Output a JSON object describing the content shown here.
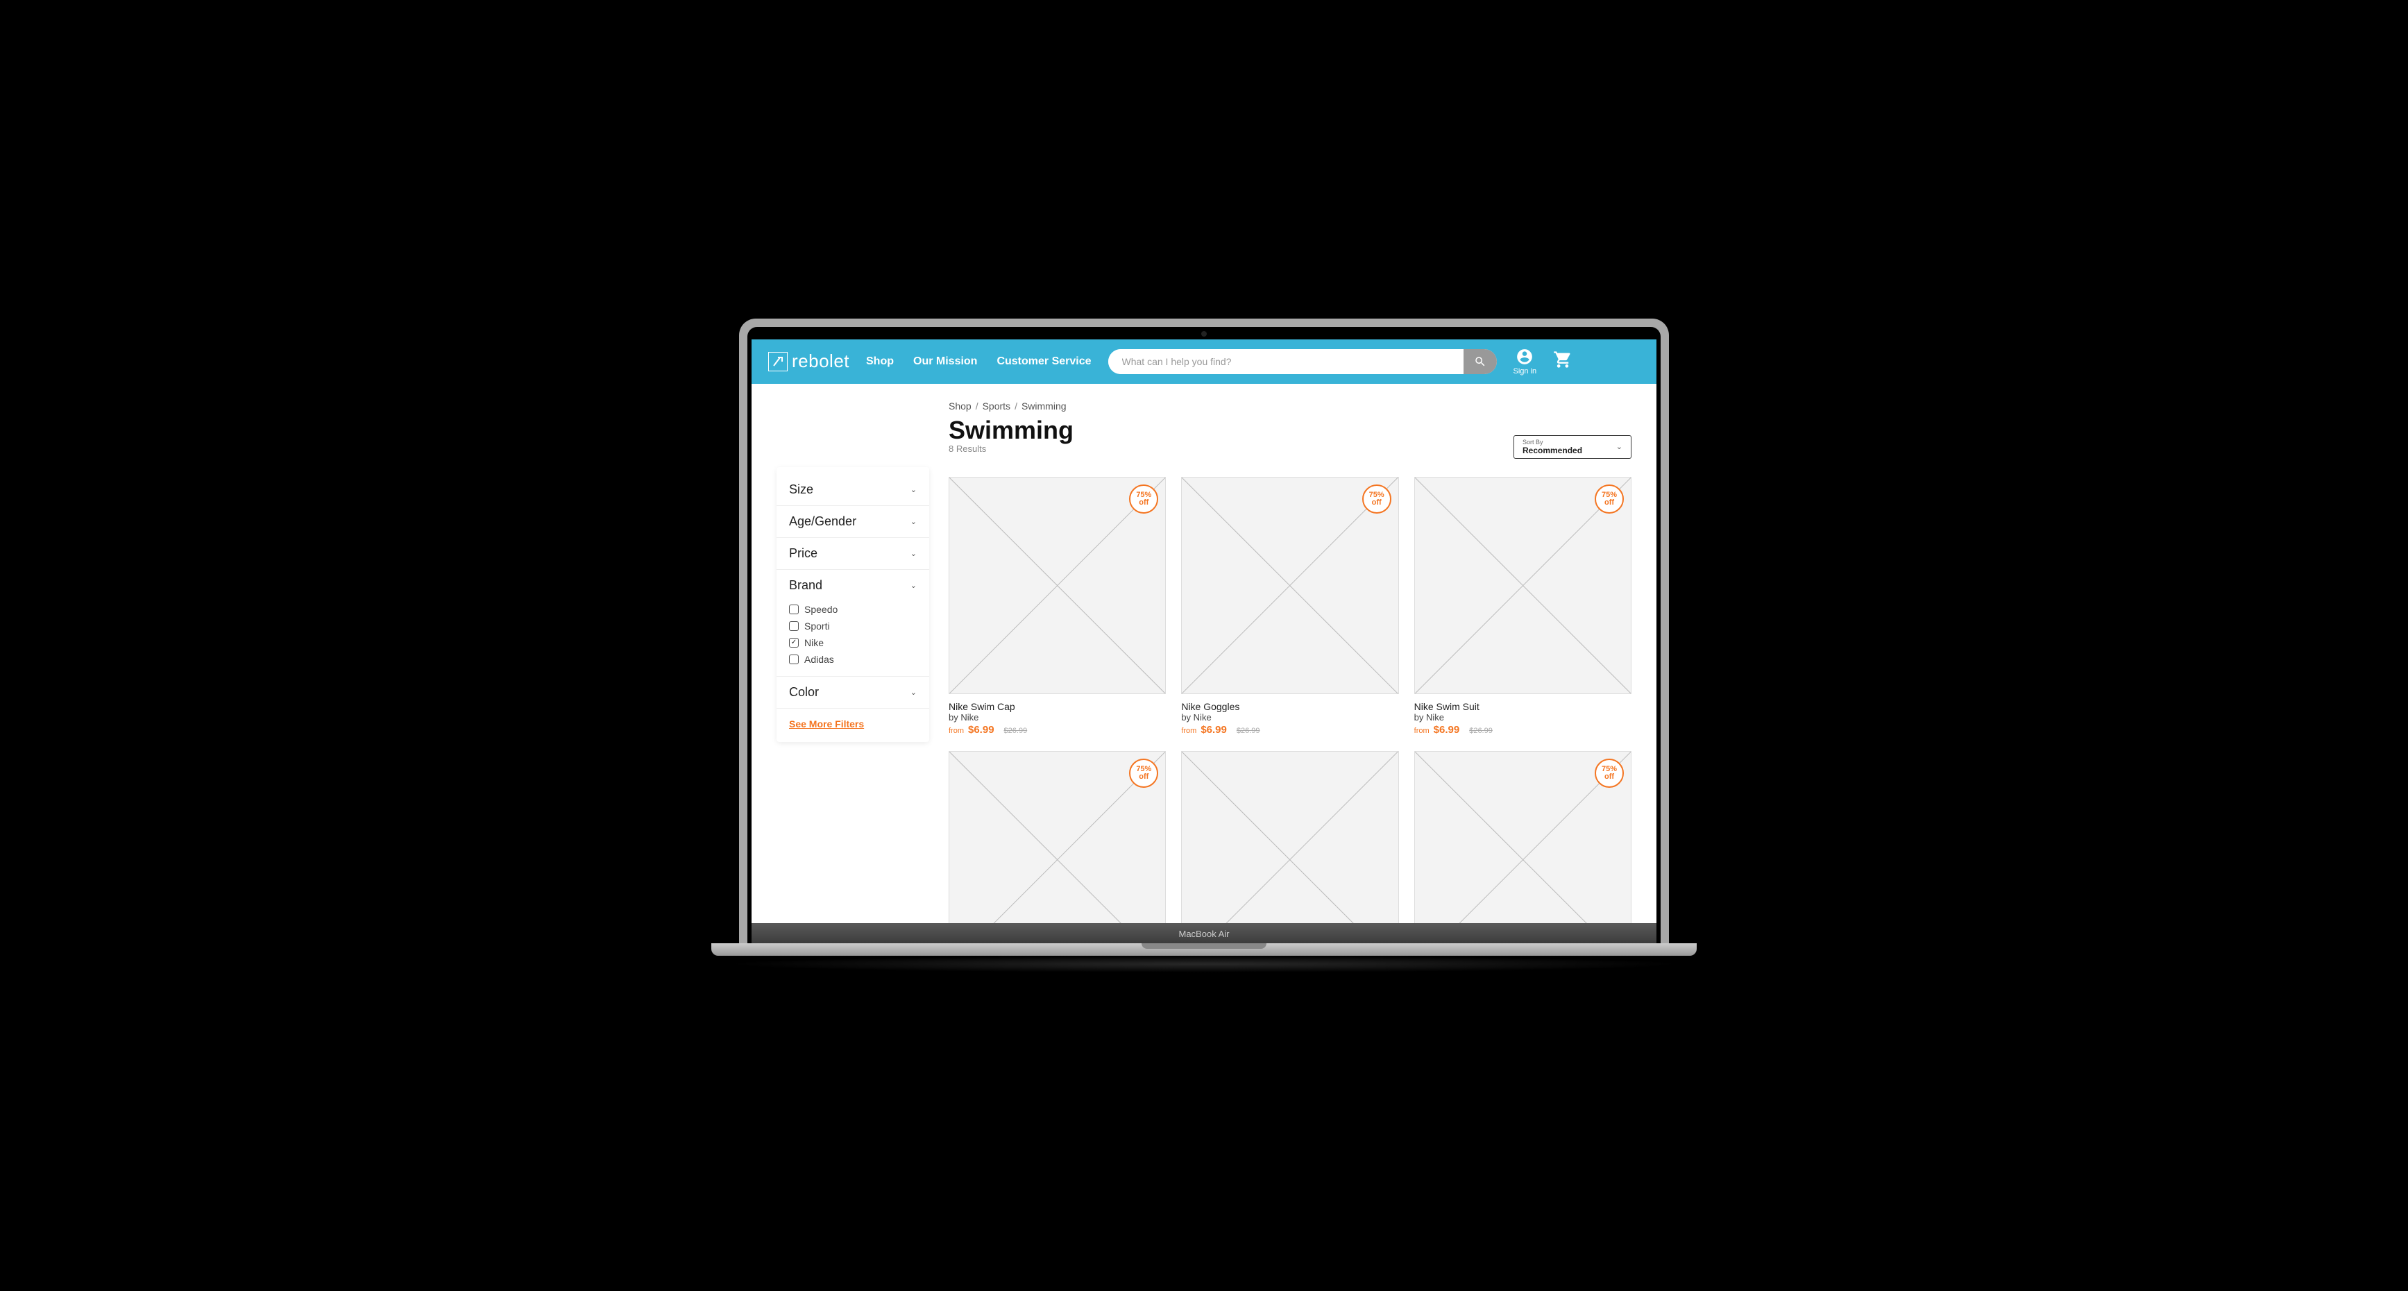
{
  "brand_name": "rebolet",
  "nav": [
    "Shop",
    "Our Mission",
    "Customer Service"
  ],
  "search_placeholder": "What can I help you find?",
  "account_label": "Sign in",
  "breadcrumb": [
    "Shop",
    "Sports",
    "Swimming"
  ],
  "page_title": "Swimming",
  "results_count": "8 Results",
  "sort_label": "Sort By",
  "sort_value": "Recommended",
  "filters": [
    {
      "title": "Size",
      "expanded": false
    },
    {
      "title": "Age/Gender",
      "expanded": false
    },
    {
      "title": "Price",
      "expanded": false
    },
    {
      "title": "Brand",
      "expanded": true,
      "options": [
        {
          "label": "Speedo",
          "checked": false
        },
        {
          "label": "Sporti",
          "checked": false
        },
        {
          "label": "Nike",
          "checked": true
        },
        {
          "label": "Adidas",
          "checked": false
        }
      ]
    },
    {
      "title": "Color",
      "expanded": false
    }
  ],
  "see_more_label": "See More Filters",
  "badge_line1": "75%",
  "badge_line2": "off",
  "price_prefix": "from",
  "by_prefix": "by",
  "products": [
    {
      "title": "Nike Swim Cap",
      "brand": "Nike",
      "price": "$6.99",
      "old": "$26.99",
      "badge": true
    },
    {
      "title": "Nike Goggles",
      "brand": "Nike",
      "price": "$6.99",
      "old": "$26.99",
      "badge": true
    },
    {
      "title": "Nike Swim Suit",
      "brand": "Nike",
      "price": "$6.99",
      "old": "$26.99",
      "badge": true
    },
    {
      "title": "",
      "brand": "",
      "price": "",
      "old": "",
      "badge": true
    },
    {
      "title": "",
      "brand": "",
      "price": "",
      "old": "",
      "badge": false
    },
    {
      "title": "",
      "brand": "",
      "price": "",
      "old": "",
      "badge": true
    }
  ],
  "laptop_label": "MacBook Air"
}
